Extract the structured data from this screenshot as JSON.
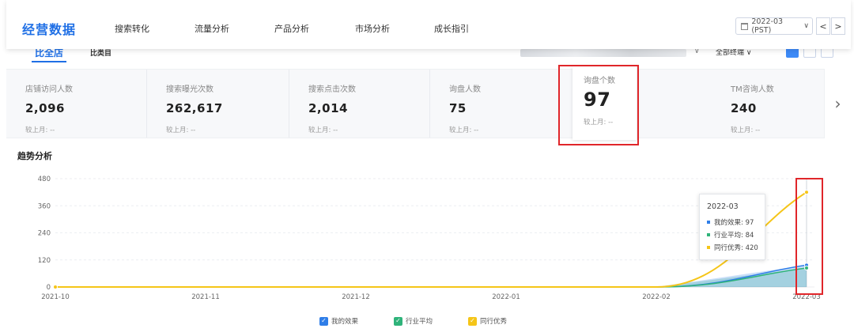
{
  "nav": {
    "brand": "经营数据",
    "items": [
      "搜索转化",
      "流量分析",
      "产品分析",
      "市场分析",
      "成长指引"
    ],
    "period": "2022-03 (PST)",
    "prev_icon": "chevron-left-icon",
    "next_icon": "chevron-right-icon",
    "calendar_icon": "calendar-icon"
  },
  "filters": {
    "active_tab": "比全店",
    "tab2": "比类目",
    "terminal": "全部终端"
  },
  "kpis": [
    {
      "label": "店铺访问人数",
      "value": "2,096",
      "compare": "较上月:  --"
    },
    {
      "label": "搜索曝光次数",
      "value": "262,617",
      "compare": "较上月:  --"
    },
    {
      "label": "搜索点击次数",
      "value": "2,014",
      "compare": "较上月:  --"
    },
    {
      "label": "询盘人数",
      "value": "75",
      "compare": "较上月:  --"
    },
    {
      "label": "询盘个数",
      "value": "97",
      "compare": "较上月:  --"
    },
    {
      "label": "TM咨询人数",
      "value": "240",
      "compare": "较上月:  --"
    }
  ],
  "trend": {
    "title": "趋势分析"
  },
  "tooltip": {
    "title": "2022-03",
    "rows": [
      {
        "label": "我的效果: 97"
      },
      {
        "label": "行业平均: 84"
      },
      {
        "label": "同行优秀: 420"
      }
    ]
  },
  "colors": {
    "brand": "#1f6fe5",
    "mine": "#2f7ee8",
    "industry": "#2fb37a",
    "top": "#f5c518",
    "highlight": "#e0262a"
  },
  "chart_data": {
    "type": "line",
    "categories": [
      "2021-10",
      "2021-11",
      "2021-12",
      "2022-01",
      "2022-02",
      "2022-03"
    ],
    "series": [
      {
        "name": "我的效果",
        "values": [
          0,
          0,
          0,
          0,
          0,
          97
        ]
      },
      {
        "name": "行业平均",
        "values": [
          0,
          0,
          0,
          0,
          0,
          84
        ]
      },
      {
        "name": "同行优秀",
        "values": [
          0,
          0,
          0,
          0,
          0,
          420
        ]
      }
    ],
    "yticks": [
      0,
      120,
      240,
      360,
      480
    ],
    "ylim": [
      0,
      480
    ],
    "grid": true,
    "legend_position": "bottom-center"
  }
}
